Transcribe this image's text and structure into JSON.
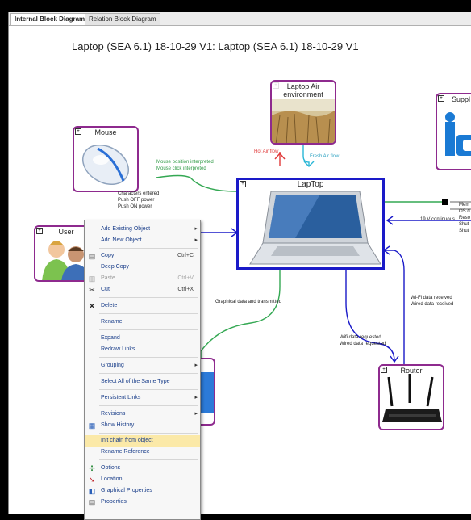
{
  "tabs": [
    "Internal Block Diagram",
    "Relation Block Diagram"
  ],
  "diagram_title": "Laptop (SEA 6.1) 18-10-29 V1: Laptop (SEA 6.1) 18-10-29 V1",
  "nodes": {
    "laptop": "LapTop",
    "air": "Laptop Air environment",
    "mouse": "Mouse",
    "user": "User",
    "router": "Router",
    "supply": "Suppl"
  },
  "flows": {
    "hot_air": "Hot Air flow",
    "fresh_air": "Fresh Air flow",
    "mouse": [
      "Mouse position interpreted",
      "Mouse click interpreted"
    ],
    "user": [
      "Characters entered",
      "Push OFF power",
      "Push ON power"
    ],
    "display": "Graphical data and transmitted",
    "router_in": [
      "Wi-Fi data received",
      "Wired data received"
    ],
    "router_out": [
      "Wifi data requested",
      "Wired data requested"
    ],
    "supply": "19 V continuous",
    "right_cut": [
      "Mem",
      "OS d",
      "Reso",
      "Shut",
      "Shut"
    ]
  },
  "colors": {
    "node_border": "#8e2a8e",
    "laptop_border": "#1a1ac8",
    "menu_text": "#1a3e8a",
    "highlight": "#fbe9a8"
  },
  "menu": {
    "items": [
      {
        "label": "Add Existing Object",
        "arrow": "▸",
        "icon": ""
      },
      {
        "label": "Add New Object",
        "arrow": "▸",
        "icon": ""
      },
      {
        "label": "Copy",
        "shortcut": "Ctrl+C",
        "icon": "copy-icon"
      },
      {
        "label": "Deep Copy",
        "icon": ""
      },
      {
        "label": "Paste",
        "shortcut": "Ctrl+V",
        "icon": "paste-icon",
        "disabled": true
      },
      {
        "label": "Cut",
        "shortcut": "Ctrl+X",
        "icon": "cut-icon"
      },
      {
        "label": "Delete",
        "icon": "delete-icon"
      },
      {
        "label": "Rename",
        "icon": ""
      },
      {
        "label": "Expand",
        "icon": ""
      },
      {
        "label": "Redraw Links",
        "icon": ""
      },
      {
        "label": "Grouping",
        "arrow": "▸",
        "icon": ""
      },
      {
        "label": "Select All of the Same Type",
        "icon": ""
      },
      {
        "label": "Persistent Links",
        "arrow": "▸",
        "icon": ""
      },
      {
        "label": "Revisions",
        "arrow": "▸",
        "icon": ""
      },
      {
        "label": "Show History...",
        "icon": "history-icon"
      },
      {
        "label": "Init chain from object",
        "icon": "",
        "highlighted": true
      },
      {
        "label": "Rename Reference",
        "icon": ""
      },
      {
        "label": "Options",
        "icon": "options-icon"
      },
      {
        "label": "Location",
        "icon": "location-icon"
      },
      {
        "label": "Graphical Properties",
        "icon": "graphical-properties-icon"
      },
      {
        "label": "Properties",
        "icon": "properties-icon"
      }
    ]
  }
}
